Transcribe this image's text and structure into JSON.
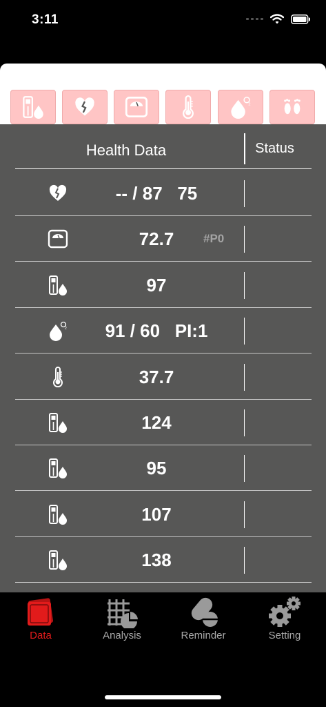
{
  "status_bar": {
    "time": "3:11",
    "icons": [
      "signal-icon",
      "wifi-icon",
      "battery-icon"
    ]
  },
  "categories": [
    {
      "name": "glucose-meter-icon"
    },
    {
      "name": "heart-icon"
    },
    {
      "name": "scale-icon"
    },
    {
      "name": "thermometer-icon"
    },
    {
      "name": "oxygen-drop-icon"
    },
    {
      "name": "footprints-icon"
    }
  ],
  "table": {
    "header_title": "Health Data",
    "header_status": "Status",
    "rows": [
      {
        "icon": "heart-icon",
        "value": "-- / 87   75",
        "extra": "",
        "status": ""
      },
      {
        "icon": "scale-icon",
        "value": "72.7",
        "extra": "#P0",
        "status": ""
      },
      {
        "icon": "glucose-meter-icon",
        "value": "97",
        "extra": "",
        "status": ""
      },
      {
        "icon": "oxygen-drop-icon",
        "value": "91 / 60   PI:1",
        "extra": "",
        "status": ""
      },
      {
        "icon": "thermometer-icon",
        "value": "37.7",
        "extra": "",
        "status": ""
      },
      {
        "icon": "glucose-meter-icon",
        "value": "124",
        "extra": "",
        "status": ""
      },
      {
        "icon": "glucose-meter-icon",
        "value": "95",
        "extra": "",
        "status": ""
      },
      {
        "icon": "glucose-meter-icon",
        "value": "107",
        "extra": "",
        "status": ""
      },
      {
        "icon": "glucose-meter-icon",
        "value": "138",
        "extra": "",
        "status": ""
      }
    ]
  },
  "tabs": [
    {
      "label": "Data",
      "icon": "data-icon",
      "active": true
    },
    {
      "label": "Analysis",
      "icon": "analysis-icon",
      "active": false
    },
    {
      "label": "Reminder",
      "icon": "reminder-icon",
      "active": false
    },
    {
      "label": "Setting",
      "icon": "setting-icon",
      "active": false
    }
  ],
  "colors": {
    "panel": "#575756",
    "category_bg": "#ffc5c5",
    "active_tab": "#e21b1b",
    "inactive_tab": "#a8a8a8"
  }
}
